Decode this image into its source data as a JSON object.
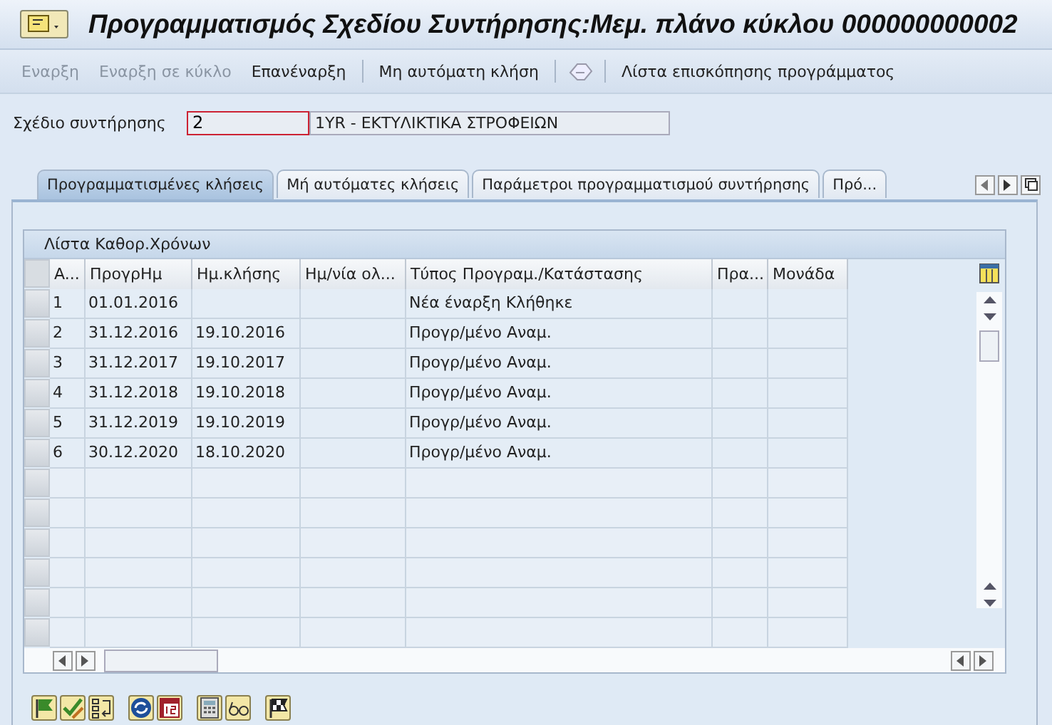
{
  "window": {
    "title": "Προγραμματισμός Σχεδίου Συντήρησης:Μεμ. πλάνο κύκλου 000000000002"
  },
  "toolbar": [
    {
      "label": "Εναρξη",
      "disabled": true
    },
    {
      "label": "Εναρξη σε κύκλο",
      "disabled": true
    },
    {
      "label": "Επανέναρξη",
      "disabled": false
    },
    {
      "label": "Μη αυτόματη κλήση",
      "disabled": false
    },
    {
      "label": "Λίστα επισκόπησης προγράμματος",
      "disabled": false
    }
  ],
  "plan_field": {
    "label": "Σχέδιο συντήρησης",
    "value": "2",
    "description": "1YR - ΕΚΤΥΛΙΚΤΙΚΑ ΣΤΡΟΦΕΙΩΝ"
  },
  "tabs": [
    {
      "label": "Προγραμματισμένες κλήσεις",
      "selected": true
    },
    {
      "label": "Μή αυτόματες κλήσεις",
      "selected": false
    },
    {
      "label": "Παράμετροι προγραμματισμού συντήρησης",
      "selected": false
    },
    {
      "label": "Πρό...",
      "selected": false
    }
  ],
  "table": {
    "title": "Λίστα Καθορ.Χρόνων",
    "columns": [
      "A...",
      "ΠρογρΗμ",
      "Ημ.κλήσης",
      "Ημ/νία ολ...",
      "Τύπος Προγραμ./Κατάστασης",
      "Πρα...",
      "Μονάδα"
    ],
    "rows": [
      [
        "1",
        "01.01.2016",
        "",
        "",
        "Νέα έναρξη Κλήθηκε",
        "",
        ""
      ],
      [
        "2",
        "31.12.2016",
        "19.10.2016",
        "",
        "Προγρ/μένο Αναμ.",
        "",
        ""
      ],
      [
        "3",
        "31.12.2017",
        "19.10.2017",
        "",
        "Προγρ/μένο Αναμ.",
        "",
        ""
      ],
      [
        "4",
        "31.12.2018",
        "19.10.2018",
        "",
        "Προγρ/μένο Αναμ.",
        "",
        ""
      ],
      [
        "5",
        "31.12.2019",
        "19.10.2019",
        "",
        "Προγρ/μένο Αναμ.",
        "",
        ""
      ],
      [
        "6",
        "30.12.2020",
        "18.10.2020",
        "",
        "Προγρ/μένο Αναμ.",
        "",
        ""
      ]
    ]
  }
}
